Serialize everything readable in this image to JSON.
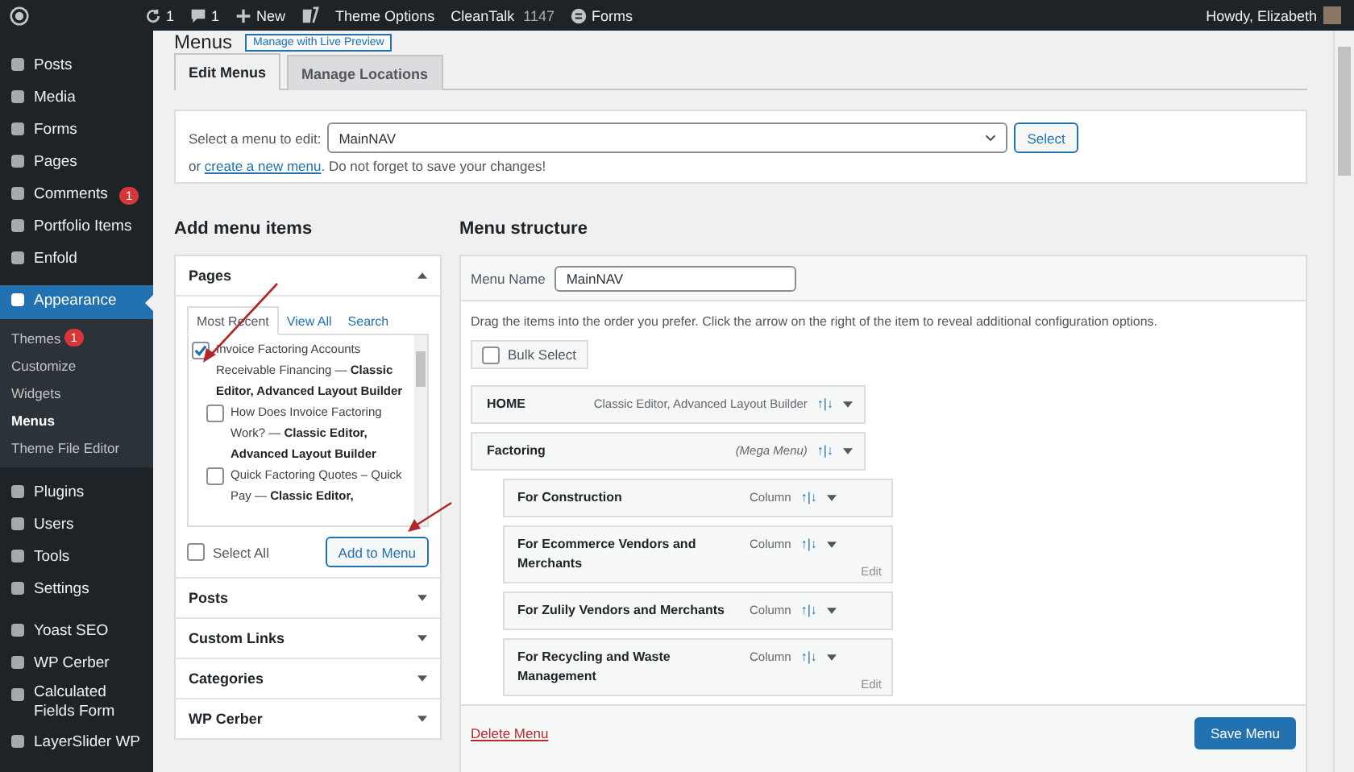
{
  "admin_bar": {
    "items": [
      {
        "kind": "refresh",
        "label": "1"
      },
      {
        "kind": "comments",
        "label": "1"
      },
      {
        "kind": "new",
        "label": "New"
      },
      {
        "kind": "logo"
      },
      {
        "kind": "text",
        "label": "Theme Options"
      },
      {
        "kind": "count",
        "label": "CleanTalk",
        "count": "1147"
      },
      {
        "kind": "forms",
        "label": "Forms"
      }
    ],
    "greeting": "Howdy, Elizabeth"
  },
  "sidebar": {
    "groups": [
      [
        {
          "label": "Posts",
          "selected": false
        },
        {
          "label": "Media",
          "selected": false
        },
        {
          "label": "Forms",
          "selected": false
        },
        {
          "label": "Pages",
          "selected": false
        },
        {
          "label": "Comments",
          "badge": "1",
          "selected": false
        },
        {
          "label": "Portfolio Items",
          "selected": false
        },
        {
          "label": "Enfold",
          "selected": false
        }
      ],
      [
        {
          "label": "Appearance",
          "selected": true,
          "children": [
            {
              "label": "Themes",
              "badge": "1",
              "selected": false
            },
            {
              "label": "Customize",
              "selected": false
            },
            {
              "label": "Widgets",
              "selected": false
            },
            {
              "label": "Menus",
              "selected": true
            },
            {
              "label": "Theme File Editor",
              "selected": false
            }
          ]
        }
      ],
      [
        {
          "label": "Plugins",
          "selected": false
        },
        {
          "label": "Users",
          "selected": false
        },
        {
          "label": "Tools",
          "selected": false
        },
        {
          "label": "Settings",
          "selected": false
        }
      ],
      [
        {
          "label": "Yoast SEO",
          "selected": false
        },
        {
          "label": "WP Cerber",
          "selected": false
        },
        {
          "label": "Calculated Fields Form",
          "selected": false
        },
        {
          "label": "LayerSlider WP",
          "selected": false
        }
      ]
    ]
  },
  "page_title": "Menus",
  "live_preview_button": "Manage with Live Preview",
  "tabs": [
    {
      "label": "Edit Menus",
      "selected": true
    },
    {
      "label": "Manage Locations",
      "selected": false
    }
  ],
  "menu_select": {
    "label": "Select a menu to edit:",
    "value": "MainNAV",
    "button": "Select",
    "hint_prefix": "or",
    "hint_link": "create a new menu",
    "hint_suffix": ". Do not forget to save your changes!"
  },
  "add_items": {
    "heading": "Add menu items",
    "panels": [
      {
        "title": "Pages",
        "expanded": true
      },
      {
        "title": "Posts",
        "expanded": false
      },
      {
        "title": "Custom Links",
        "expanded": false
      },
      {
        "title": "Categories",
        "expanded": false
      },
      {
        "title": "WP Cerber",
        "expanded": false
      }
    ],
    "page_tabs": [
      {
        "label": "Most Recent",
        "selected": true
      },
      {
        "label": "View All",
        "selected": false
      },
      {
        "label": "Search",
        "selected": false
      }
    ],
    "pages": [
      {
        "title": "Invoice Factoring Accounts Receivable Financing — **Classic Editor, Advanced Layout Builder**",
        "checked": true,
        "children": [
          {
            "title": "How Does Invoice Factoring Work? — **Classic Editor, Advanced Layout Builder**",
            "checked": false
          },
          {
            "title": "Quick Factoring Quotes – Quick Pay — **Classic Editor,**",
            "checked": false
          }
        ]
      }
    ],
    "select_all": {
      "label": "Select All",
      "checked": false
    },
    "add_button": "Add to Menu"
  },
  "structure": {
    "heading": "Menu structure",
    "name_label": "Menu Name",
    "name_value": "MainNAV",
    "instructions": "Drag the items into the order you prefer. Click the arrow on the right of the item to reveal additional configuration options.",
    "bulk_select": {
      "label": "Bulk Select",
      "checked": false
    },
    "items": [
      {
        "title": "HOME",
        "meta": "Classic Editor, Advanced Layout Builder",
        "kind": "page",
        "move": "↑|↓"
      },
      {
        "title": "Factoring",
        "meta": "(Mega Menu)",
        "kind": "mega",
        "move": "↑|↓",
        "children": [
          {
            "title": "For Construction",
            "meta": "Column",
            "kind": "column",
            "move": "↑|↓"
          },
          {
            "title": "For Ecommerce Vendors and Merchants",
            "meta": "Column",
            "kind": "column",
            "move": "↑|↓",
            "edit": "Edit"
          },
          {
            "title": "For Zulily Vendors and Merchants",
            "meta": "Column",
            "kind": "column",
            "move": "↑|↓"
          },
          {
            "title": "For Recycling and Waste Management",
            "meta": "Column",
            "kind": "column",
            "move": "↑|↓",
            "edit": "Edit"
          }
        ]
      }
    ],
    "delete_link": "Delete Menu",
    "save_button": "Save Menu"
  }
}
